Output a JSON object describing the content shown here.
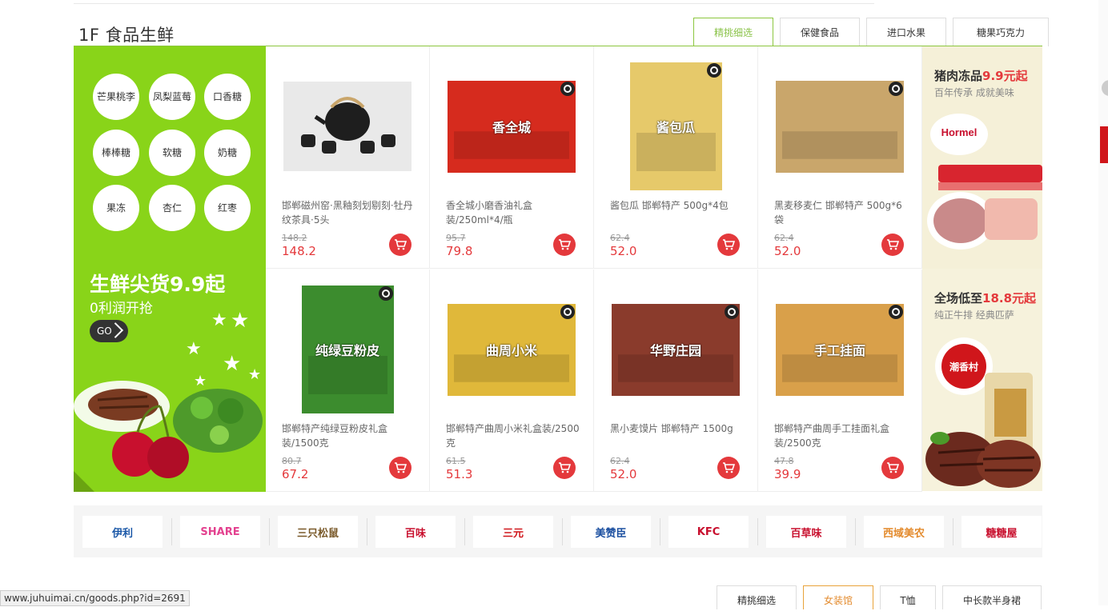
{
  "floor": {
    "title": "1F 食品生鲜"
  },
  "tabs": [
    "精挑细选",
    "保健食品",
    "进口水果",
    "糖果巧克力"
  ],
  "left": {
    "tags": [
      "芒果桃李",
      "凤梨蓝莓",
      "口香糖",
      "棒棒糖",
      "软糖",
      "奶糖",
      "果冻",
      "杏仁",
      "红枣"
    ],
    "promo_title": "生鲜尖货9.9起",
    "promo_sub": "0利润开抢",
    "go_label": "GO"
  },
  "products": [
    {
      "name": "邯郸磁州窑·黑釉刻划剔刻·牡丹纹茶具·5头",
      "old_price": "148.2",
      "price": "148.2",
      "box_text": "",
      "color": "#d8d8d8"
    },
    {
      "name": "香全城小磨香油礼盒装/250ml*4/瓶",
      "old_price": "95.7",
      "price": "79.8",
      "box_text": "香全城",
      "color": "#d62b1e"
    },
    {
      "name": "酱包瓜 邯郸特产 500g*4包",
      "old_price": "62.4",
      "price": "52.0",
      "box_text": "酱包瓜",
      "color": "#e6c96a"
    },
    {
      "name": "黑麦移麦仁 邯郸特产 500g*6袋",
      "old_price": "62.4",
      "price": "52.0",
      "box_text": "",
      "color": "#c9a66b"
    },
    {
      "name": "邯郸特产纯绿豆粉皮礼盒装/1500克",
      "old_price": "80.7",
      "price": "67.2",
      "box_text": "纯绿豆粉皮",
      "color": "#3c8c2e"
    },
    {
      "name": "邯郸特产曲周小米礼盒装/2500克",
      "old_price": "61.5",
      "price": "51.3",
      "box_text": "曲周小米",
      "color": "#e0b83a"
    },
    {
      "name": "黑小麦馍片 邯郸特产 1500g",
      "old_price": "62.4",
      "price": "52.0",
      "box_text": "华野庄园",
      "color": "#8a3b2c"
    },
    {
      "name": "邯郸特产曲周手工挂面礼盒装/2500克",
      "old_price": "47.8",
      "price": "39.9",
      "box_text": "手工挂面",
      "color": "#d9a04a"
    }
  ],
  "right": [
    {
      "title_pre": "猪肉冻品",
      "title_hl": "9.9元起",
      "sub": "百年传承 成就美味",
      "brand": "Hormel"
    },
    {
      "title_pre": "全场低至",
      "title_hl": "18.8元起",
      "sub": "纯正牛排  经典匹萨",
      "brand": "潮香村"
    }
  ],
  "brands": [
    "伊利",
    "SHARE",
    "三只松鼠",
    "百味",
    "三元",
    "美赞臣",
    "KFC",
    "百草味",
    "西域美农",
    "糖糖屋"
  ],
  "colors": {
    "accent": "#8cc63f",
    "price": "#e4393c",
    "left_bg": "#89d419"
  },
  "tabs2": [
    "精挑细选",
    "女装馆",
    "T恤",
    "中长款半身裙"
  ],
  "status_url": "www.juhuimai.cn/goods.php?id=2691"
}
